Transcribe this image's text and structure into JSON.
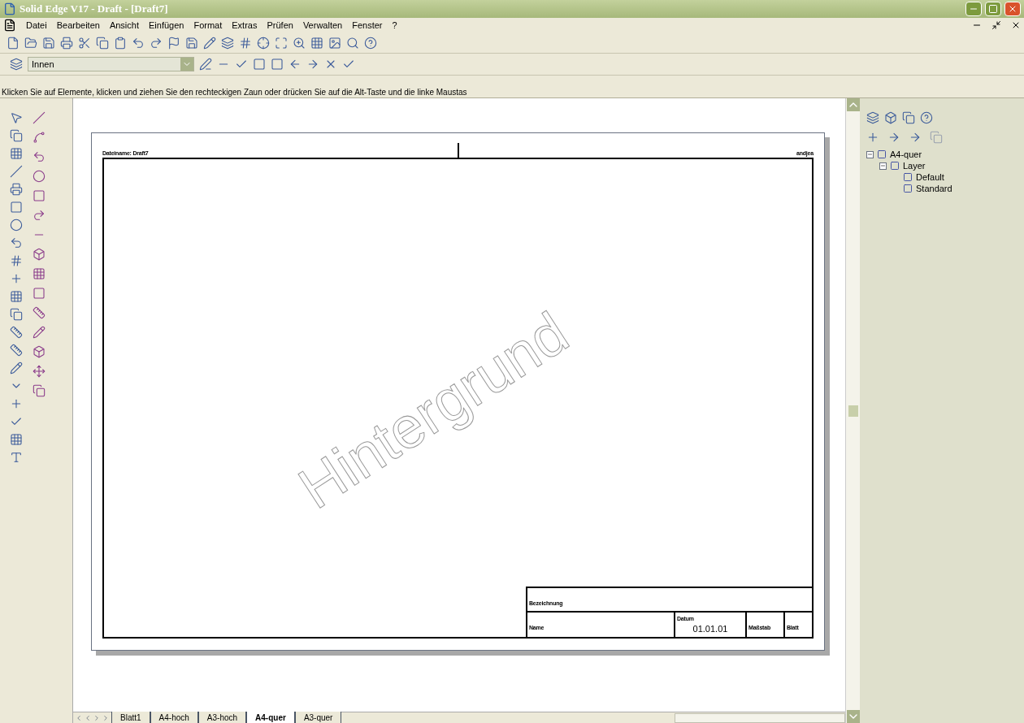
{
  "window": {
    "title": "Solid Edge V17 - Draft - [Draft7]"
  },
  "menu": [
    "Datei",
    "Bearbeiten",
    "Ansicht",
    "Einfügen",
    "Format",
    "Extras",
    "Prüfen",
    "Verwalten",
    "Fenster",
    "?"
  ],
  "style_combo": {
    "value": "Innen"
  },
  "prompt": "Klicken Sie auf Elemente, klicken und ziehen Sie den rechteckigen Zaun oder drücken Sie auf die Alt-Taste und die linke Maustas",
  "sheet": {
    "file_label": "Dateiname: Draft7",
    "user_label": "andjea",
    "background_label": "Hintergrund",
    "title_block": {
      "designation": "Bezeichnung",
      "name": "Name",
      "date_label": "Datum",
      "date_value": "01.01.01",
      "scale": "Maßstab",
      "sheet": "Blatt"
    }
  },
  "layer_tree": [
    {
      "label": "A4-quer",
      "expanded": true,
      "children": [
        {
          "label": "Layer",
          "expanded": true,
          "children": [
            {
              "label": "Default"
            },
            {
              "label": "Standard"
            }
          ]
        }
      ]
    }
  ],
  "sheet_tabs": [
    {
      "label": "Blatt1",
      "selected": false
    },
    {
      "label": "A4-hoch",
      "selected": false
    },
    {
      "label": "A3-hoch",
      "selected": false
    },
    {
      "label": "A4-quer",
      "selected": true
    },
    {
      "label": "A3-quer",
      "selected": false
    }
  ]
}
